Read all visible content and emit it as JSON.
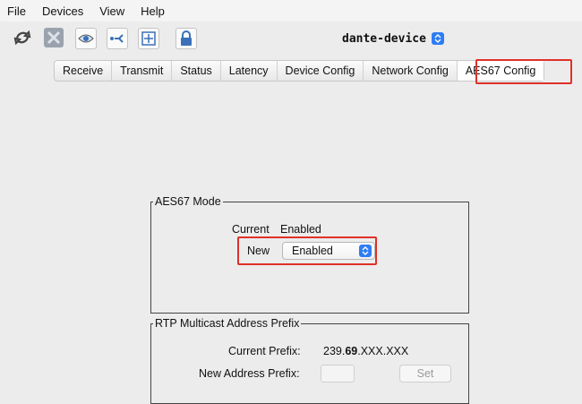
{
  "menu": {
    "items": [
      "File",
      "Devices",
      "View",
      "Help"
    ]
  },
  "toolbar": {
    "icons": [
      "refresh-icon",
      "tools-icon",
      "eye-icon",
      "network-icon",
      "add-icon",
      "lock-icon"
    ],
    "device_name": "dante-device"
  },
  "tabs": {
    "items": [
      "Receive",
      "Transmit",
      "Status",
      "Latency",
      "Device Config",
      "Network Config",
      "AES67 Config"
    ],
    "active": "AES67 Config"
  },
  "aes67_mode": {
    "title": "AES67 Mode",
    "current_label": "Current",
    "current_value": "Enabled",
    "new_label": "New",
    "new_value": "Enabled"
  },
  "rtp_prefix": {
    "title": "RTP Multicast Address Prefix",
    "current_label": "Current Prefix:",
    "current_value_part1": "239.",
    "current_value_bold": "69",
    "current_value_part2": ".XXX.XXX",
    "new_label": "New Address Prefix:",
    "new_value": "",
    "set_label": "Set"
  },
  "colors": {
    "highlight": "#e0302a",
    "accent": "#2f7cf6"
  }
}
